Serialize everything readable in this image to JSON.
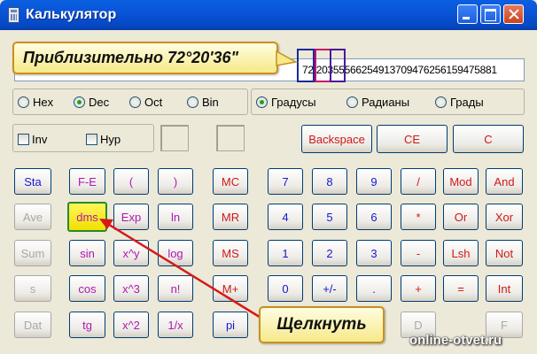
{
  "window": {
    "title": "Калькулятор"
  },
  "display": {
    "value": "72.20355566254913709476256159475881"
  },
  "callouts": {
    "top": "Приблизительно 72°20'36\"",
    "bottom": "Щелкнуть"
  },
  "number_system": {
    "options": [
      "Hex",
      "Dec",
      "Oct",
      "Bin"
    ],
    "selected": "Dec"
  },
  "angle_units": {
    "options": [
      "Градусы",
      "Радианы",
      "Грады"
    ],
    "selected": "Градусы"
  },
  "checkboxes": {
    "inv": "Inv",
    "hyp": "Hyp"
  },
  "buttons": {
    "backspace": "Backspace",
    "ce": "CE",
    "c": "C",
    "sta": "Sta",
    "ave": "Ave",
    "sum": "Sum",
    "s": "s",
    "dat": "Dat",
    "fe": "F-E",
    "lparen": "(",
    "rparen": ")",
    "dms": "dms",
    "exp": "Exp",
    "ln": "ln",
    "sin": "sin",
    "xy": "x^y",
    "log": "log",
    "cos": "cos",
    "x3": "x^3",
    "nfact": "n!",
    "tg": "tg",
    "x2": "x^2",
    "inv_x": "1/x",
    "mc": "MC",
    "mr": "MR",
    "ms": "MS",
    "mplus": "M+",
    "pi": "pi",
    "d7": "7",
    "d8": "8",
    "d9": "9",
    "div": "/",
    "mod": "Mod",
    "and": "And",
    "d4": "4",
    "d5": "5",
    "d6": "6",
    "mul": "*",
    "or": "Or",
    "xor": "Xor",
    "d1": "1",
    "d2": "2",
    "d3": "3",
    "sub": "-",
    "lsh": "Lsh",
    "not": "Not",
    "d0": "0",
    "plusminus": "+/-",
    "dot": ".",
    "add": "+",
    "eq": "=",
    "int": "Int",
    "hex_d": "D",
    "hex_f": "F"
  },
  "watermark": "online-otvet.ru",
  "colors": {
    "blue_label": "#1818d0",
    "red_label": "#d01818",
    "purple_label": "#b018b0",
    "highlight": "#f0e000"
  }
}
